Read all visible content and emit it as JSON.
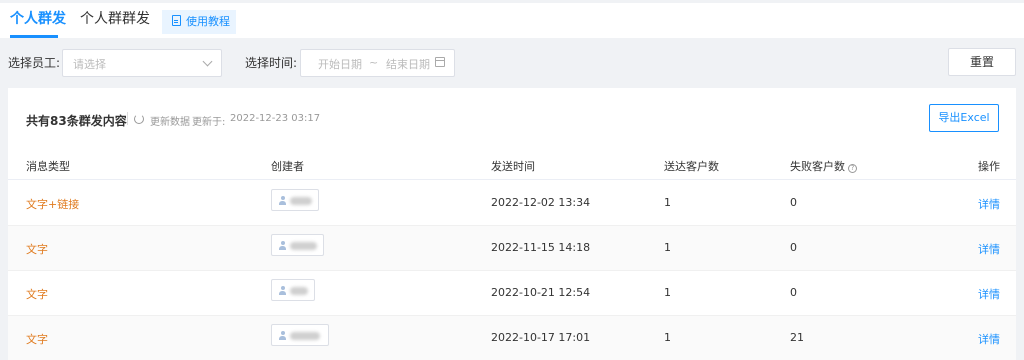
{
  "tabs": [
    {
      "label": "个人群发",
      "active": true
    },
    {
      "label": "个人群群发",
      "active": false
    }
  ],
  "guide_button": {
    "label": "使用教程",
    "icon": "document-icon"
  },
  "filters": {
    "employee_label": "选择员工:",
    "employee_placeholder": "请选择",
    "time_label": "选择时间:",
    "start_placeholder": "开始日期",
    "separator": "~",
    "end_placeholder": "结束日期"
  },
  "reset_label": "重置",
  "summary": {
    "title": "共有83条群发内容",
    "refresh_label": "更新数据",
    "updated_label": "更新于:",
    "updated_time": "2022-12-23 03:17"
  },
  "export_label": "导出Excel",
  "table": {
    "columns": [
      "消息类型",
      "创建者",
      "发送时间",
      "送达客户数",
      "失败客户数",
      "操作"
    ],
    "rows": [
      {
        "type": "文字+链接",
        "sent": "2022-12-02 13:34",
        "delivered": "1",
        "failed": "0",
        "action": "详情"
      },
      {
        "type": "文字",
        "sent": "2022-11-15 14:18",
        "delivered": "1",
        "failed": "0",
        "action": "详情"
      },
      {
        "type": "文字",
        "sent": "2022-10-21 12:54",
        "delivered": "1",
        "failed": "0",
        "action": "详情"
      },
      {
        "type": "文字",
        "sent": "2022-10-17 17:01",
        "delivered": "1",
        "failed": "21",
        "action": "详情"
      }
    ]
  },
  "colors": {
    "accent": "#1890ff",
    "type_text": "#e07b1f",
    "background": "#f0f2f5"
  }
}
